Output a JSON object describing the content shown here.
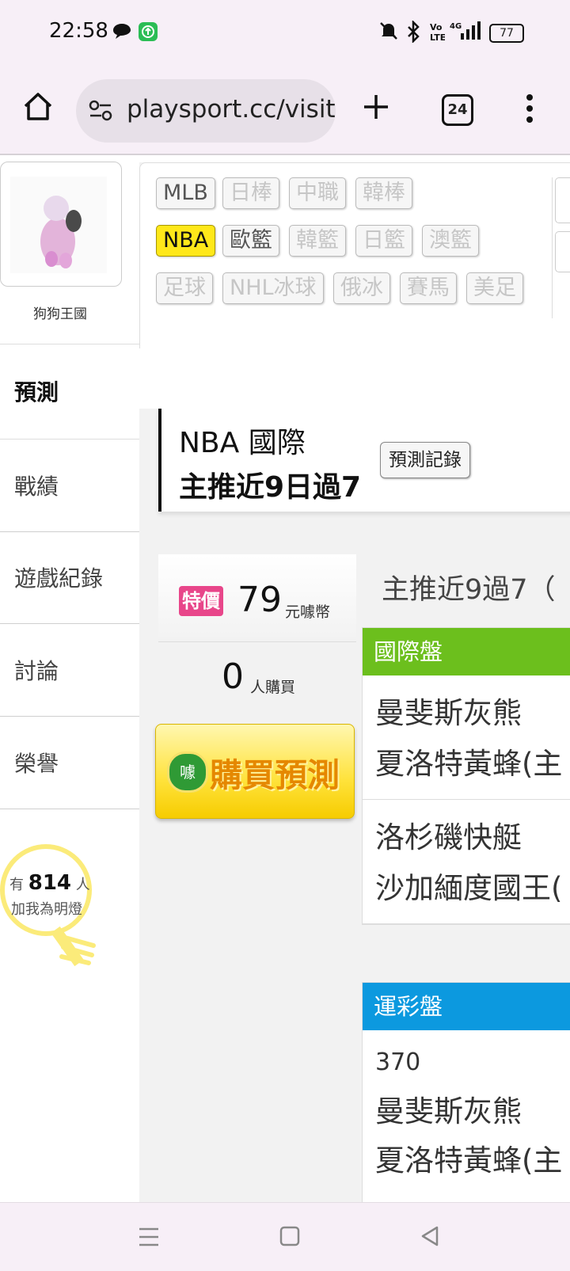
{
  "status_bar": {
    "time": "22:58",
    "battery": "77",
    "network": "4G"
  },
  "browser": {
    "url": "playsport.cc/visit",
    "tab_count": "24"
  },
  "sidebar": {
    "username": "狗狗王國",
    "nav": [
      {
        "label": "預測"
      },
      {
        "label": "戰績"
      },
      {
        "label": "遊戲紀錄"
      },
      {
        "label": "討論"
      },
      {
        "label": "榮譽"
      }
    ],
    "fans": {
      "prefix": "有",
      "count": "814",
      "suffix": "人",
      "line2": "加我為明燈"
    }
  },
  "sports": {
    "row1": [
      "MLB",
      "日棒",
      "中職",
      "韓棒"
    ],
    "row2": [
      "NBA",
      "歐籃",
      "韓籃",
      "日籃",
      "澳籃"
    ],
    "row3": [
      "足球",
      "NHL冰球",
      "俄冰",
      "賽馬",
      "美足"
    ]
  },
  "prediction": {
    "league": "NBA 國際",
    "streak": "主推近9日過7",
    "record_button": "預測記錄",
    "title": "主推近9過7（",
    "price_tag": "特價",
    "price": "79",
    "price_unit": "元噱幣",
    "buyers": "0",
    "buyers_unit": "人購買",
    "buy_button": "購買預測",
    "buy_logo": "噱"
  },
  "cards": {
    "international": {
      "header": "國際盤",
      "color": "#6cbf1d",
      "games": [
        [
          "曼斐斯灰熊",
          "夏洛特黃蜂(主"
        ],
        [
          "洛杉磯快艇",
          "沙加緬度國王("
        ]
      ]
    },
    "sports_lottery": {
      "header": "運彩盤",
      "color": "#0c99df",
      "games": [
        [
          "370",
          "曼斐斯灰熊",
          "夏洛特黃蜂(主"
        ]
      ]
    }
  }
}
